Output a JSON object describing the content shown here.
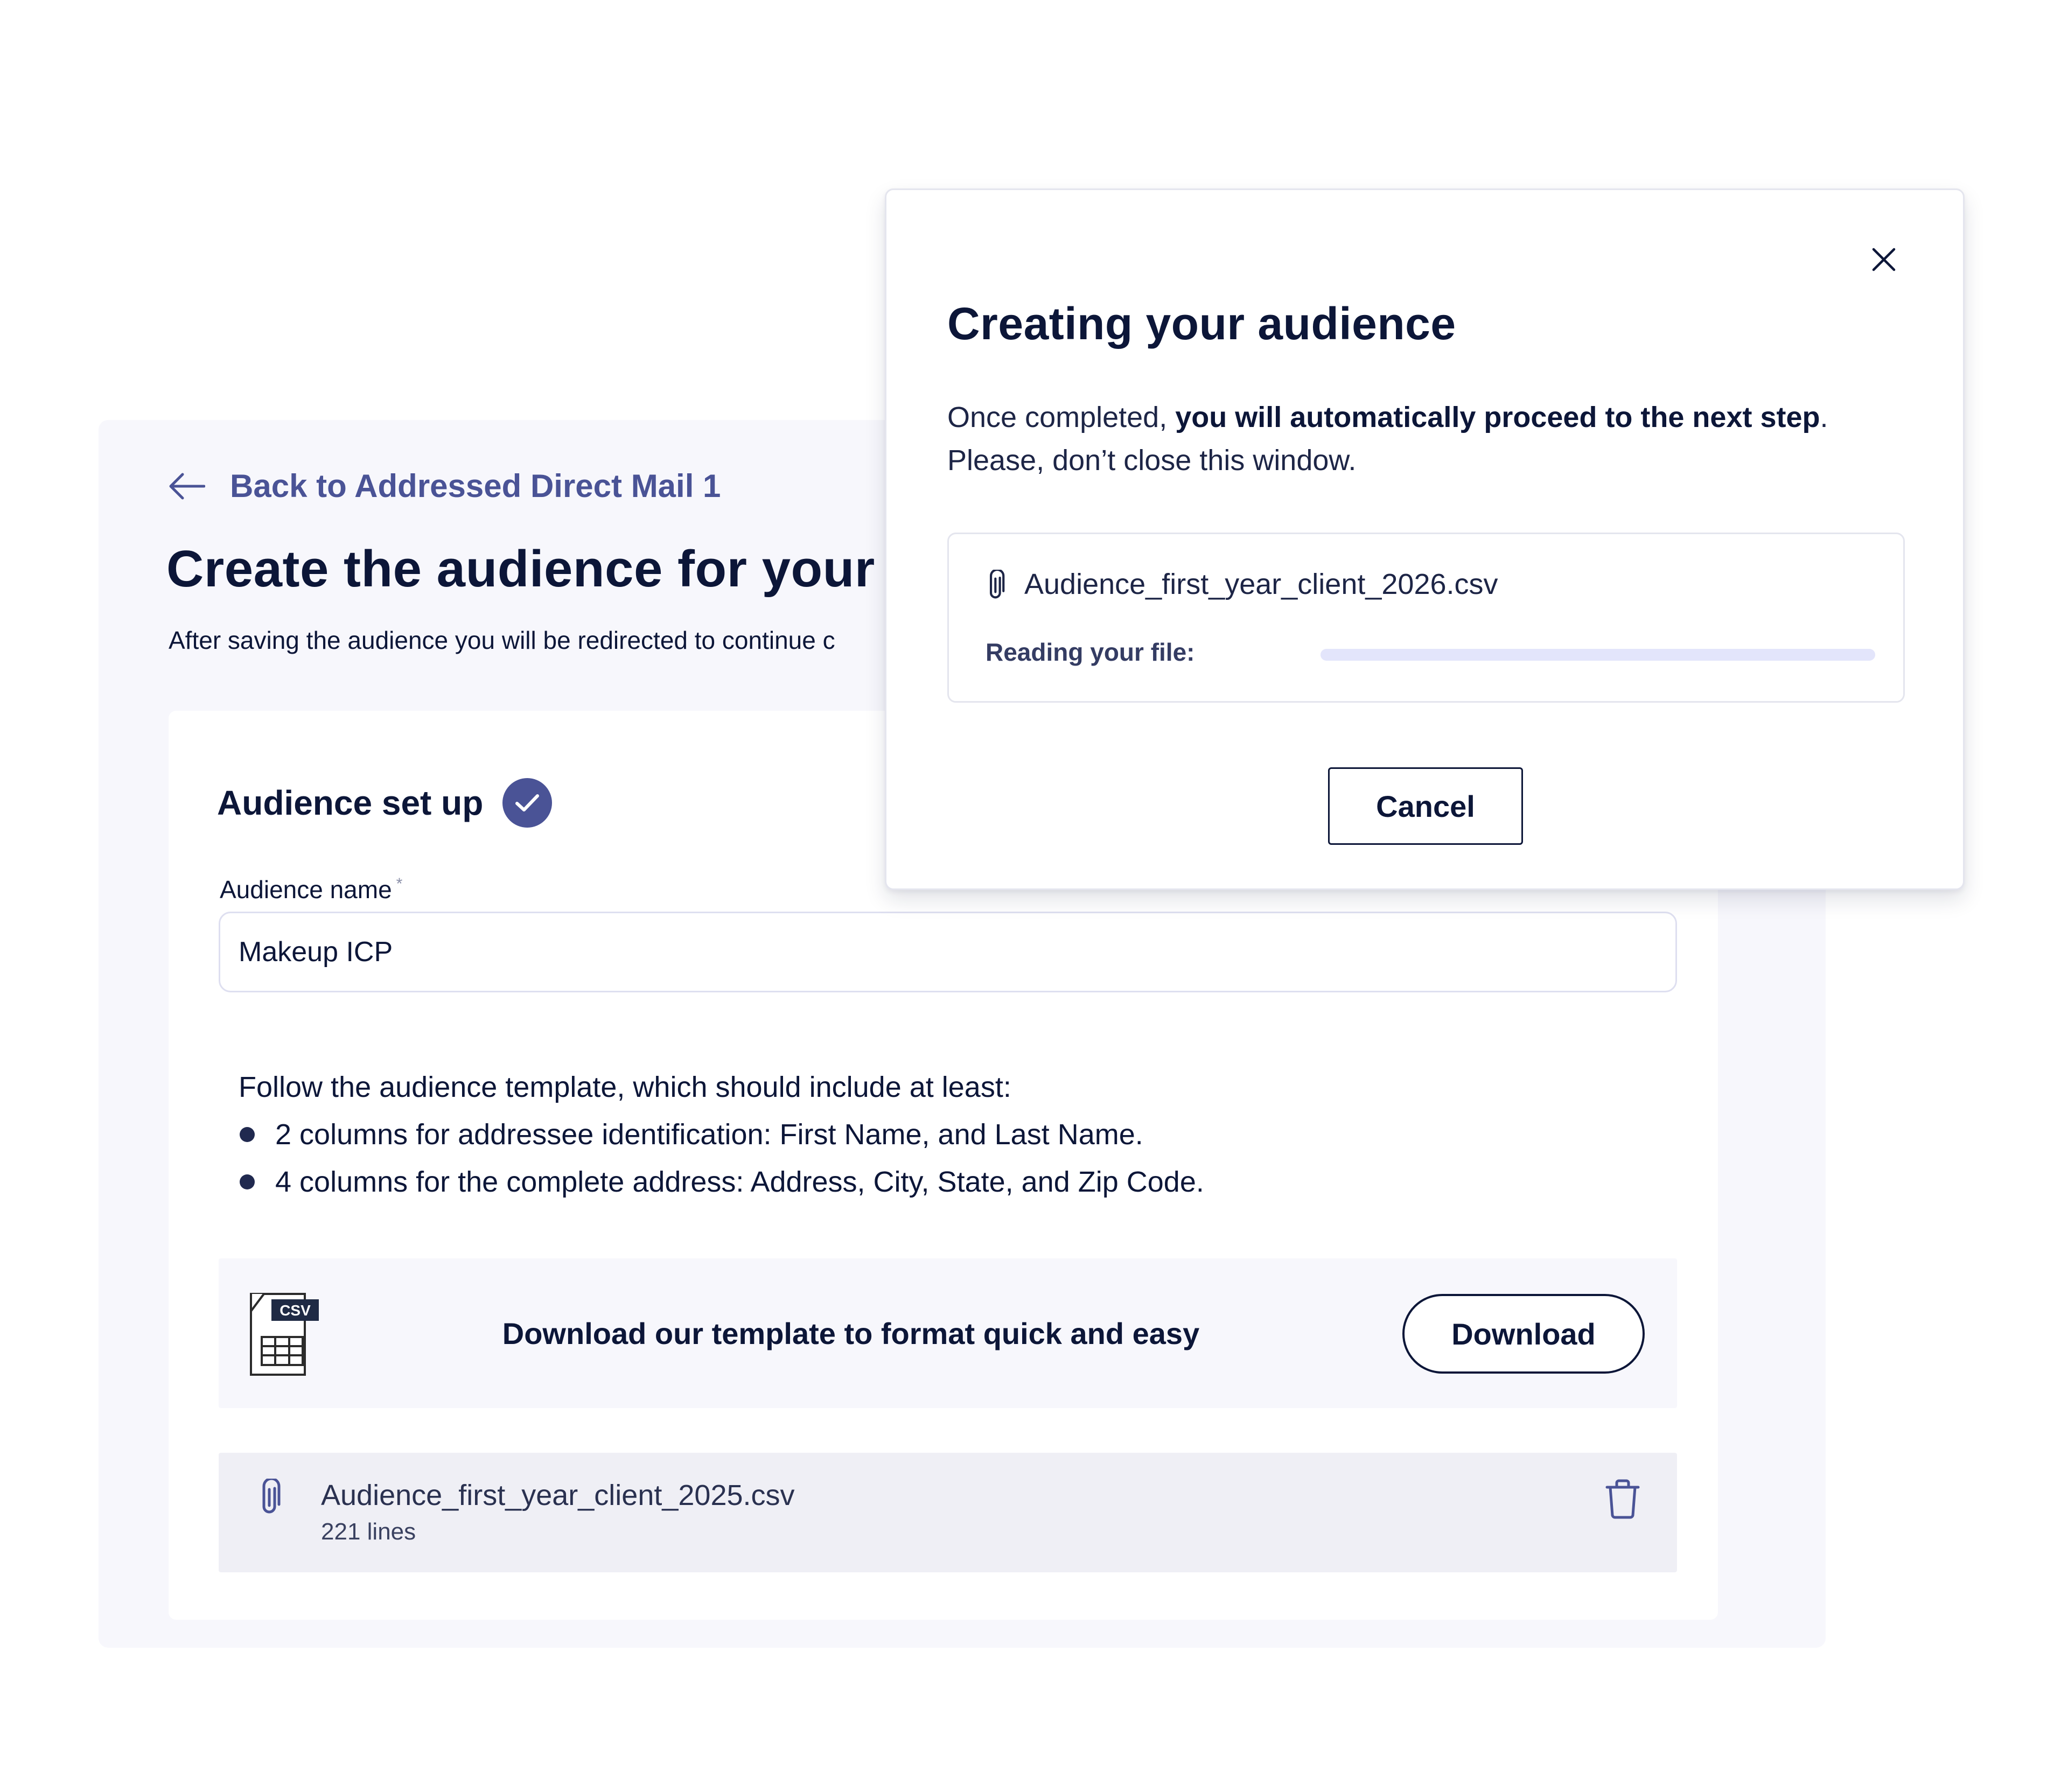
{
  "page": {
    "back_link": "Back to Addressed Direct Mail 1",
    "title": "Create the audience for your c",
    "subtitle": "After saving the audience you will be redirected to continue c"
  },
  "audience_setup": {
    "section_title": "Audience set up",
    "name_label": "Audience name",
    "required_marker": "*",
    "name_value": "Makeup ICP",
    "instructions_intro": "Follow the audience template, which should include at least:",
    "instructions": [
      "2 columns for addressee identification: First Name, and Last Name.",
      "4 columns for the complete address: Address, City, State, and Zip Code."
    ],
    "template_badge": "CSV",
    "template_text": "Download our template to format quick and easy",
    "download_label": "Download",
    "file_name": "Audience_first_year_client_2025.csv",
    "file_lines": "221 lines"
  },
  "modal": {
    "title": "Creating your audience",
    "desc_prefix": "Once completed,",
    "desc_bold": "you will automatically proceed to the next step",
    "desc_suffix": ".",
    "desc_line2": "Please, don’t close this window.",
    "file_name": "Audience_first_year_client_2026.csv",
    "reading_label": "Reading your file:",
    "progress_percent": 0,
    "cancel_label": "Cancel"
  },
  "colors": {
    "accent": "#4a5396",
    "text": "#0c1638",
    "progress_track": "#e3e5fb"
  },
  "icons": [
    "arrow-left-icon",
    "check-icon",
    "csv-file-icon",
    "paperclip-icon",
    "trash-icon",
    "close-icon"
  ]
}
